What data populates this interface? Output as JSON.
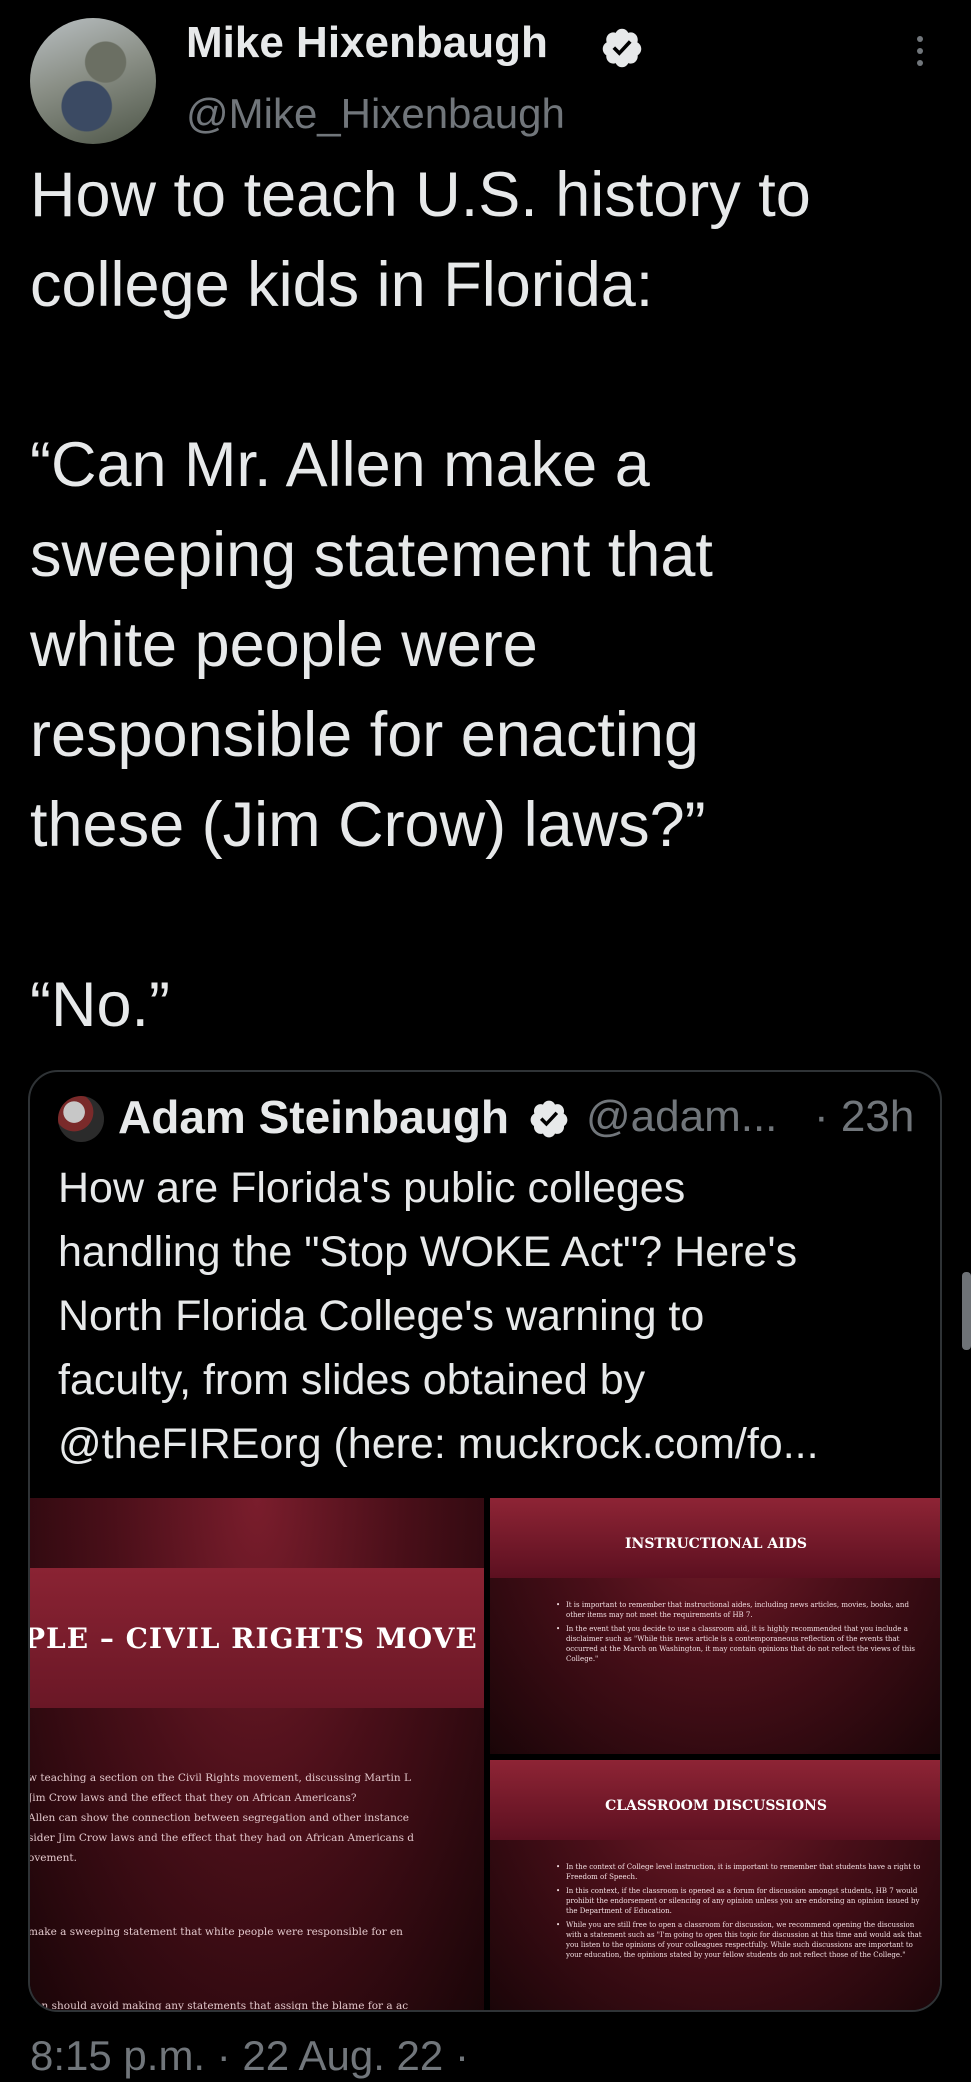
{
  "author": {
    "name": "Mike Hixenbaugh",
    "handle": "@Mike_Hixenbaugh",
    "verified_icon": "verified-badge-icon"
  },
  "tweet": {
    "text": "How to teach U.S. history to\ncollege kids in Florida:\n\n“Can Mr. Allen make a\nsweeping statement that\nwhite people were\nresponsible for enacting\nthese (Jim Crow) laws?”\n\n“No.”",
    "timestamp": "8:15 p.m. · 22 Aug. 22 ·"
  },
  "quoted_tweet": {
    "author_name": "Adam Steinbaugh",
    "handle": "@adam...",
    "time": "· 23h",
    "text": "How are Florida's public colleges\nhandling the \"Stop WOKE Act\"? Here's\nNorth Florida College's warning to\nfaculty, from slides obtained by\n@theFIREorg (here: muckrock.com/fo..."
  },
  "slides": {
    "left": {
      "title": "PLE – CIVIL RIGHTS MOVE",
      "paragraphs": [
        "w teaching a section on the Civil Rights movement, discussing Martin L\nJim Crow laws and the effect that they on African Americans?\nAllen can show the connection between segregation and other instance\nsider Jim Crow laws and the effect that they had on African Americans d\novement.",
        "make a sweeping statement that white people were responsible for en",
        "Zen should avoid making any statements that assign the blame for a ac\nr race, though exploring the motives of the specific individuals that en\n permitted."
      ]
    },
    "top_right": {
      "title": "INSTRUCTIONAL AIDS",
      "bullets": [
        "It is important to remember that instructional aides, including news articles, movies, books, and other items may not meet the requirements of HB 7.",
        "In the event that you decide to use a classroom aid, it is highly recommended that you include a disclaimer such as \"While this news article is a contemporaneous reflection of the events that occurred at the March on Washington, it may contain opinions that do not reflect the views of this College.\""
      ]
    },
    "bottom_right": {
      "title": "CLASSROOM DISCUSSIONS",
      "bullets": [
        "In the context of College level instruction, it is important to remember that students have a right to Freedom of Speech.",
        "In this context, if the classroom is opened as a forum for discussion amongst students, HB 7 would prohibit the endorsement or silencing of any opinion unless you are endorsing an opinion issued by the Department of Education.",
        "While you are still free to open a classroom for discussion, we recommend opening the discussion with a statement such as \"I'm going to open this topic for discussion at this time and would ask that you listen to the opinions of your colleagues respectfully. While such discussions are important to your education, the opinions stated by your fellow students do not reflect those of the College.\""
      ]
    }
  }
}
